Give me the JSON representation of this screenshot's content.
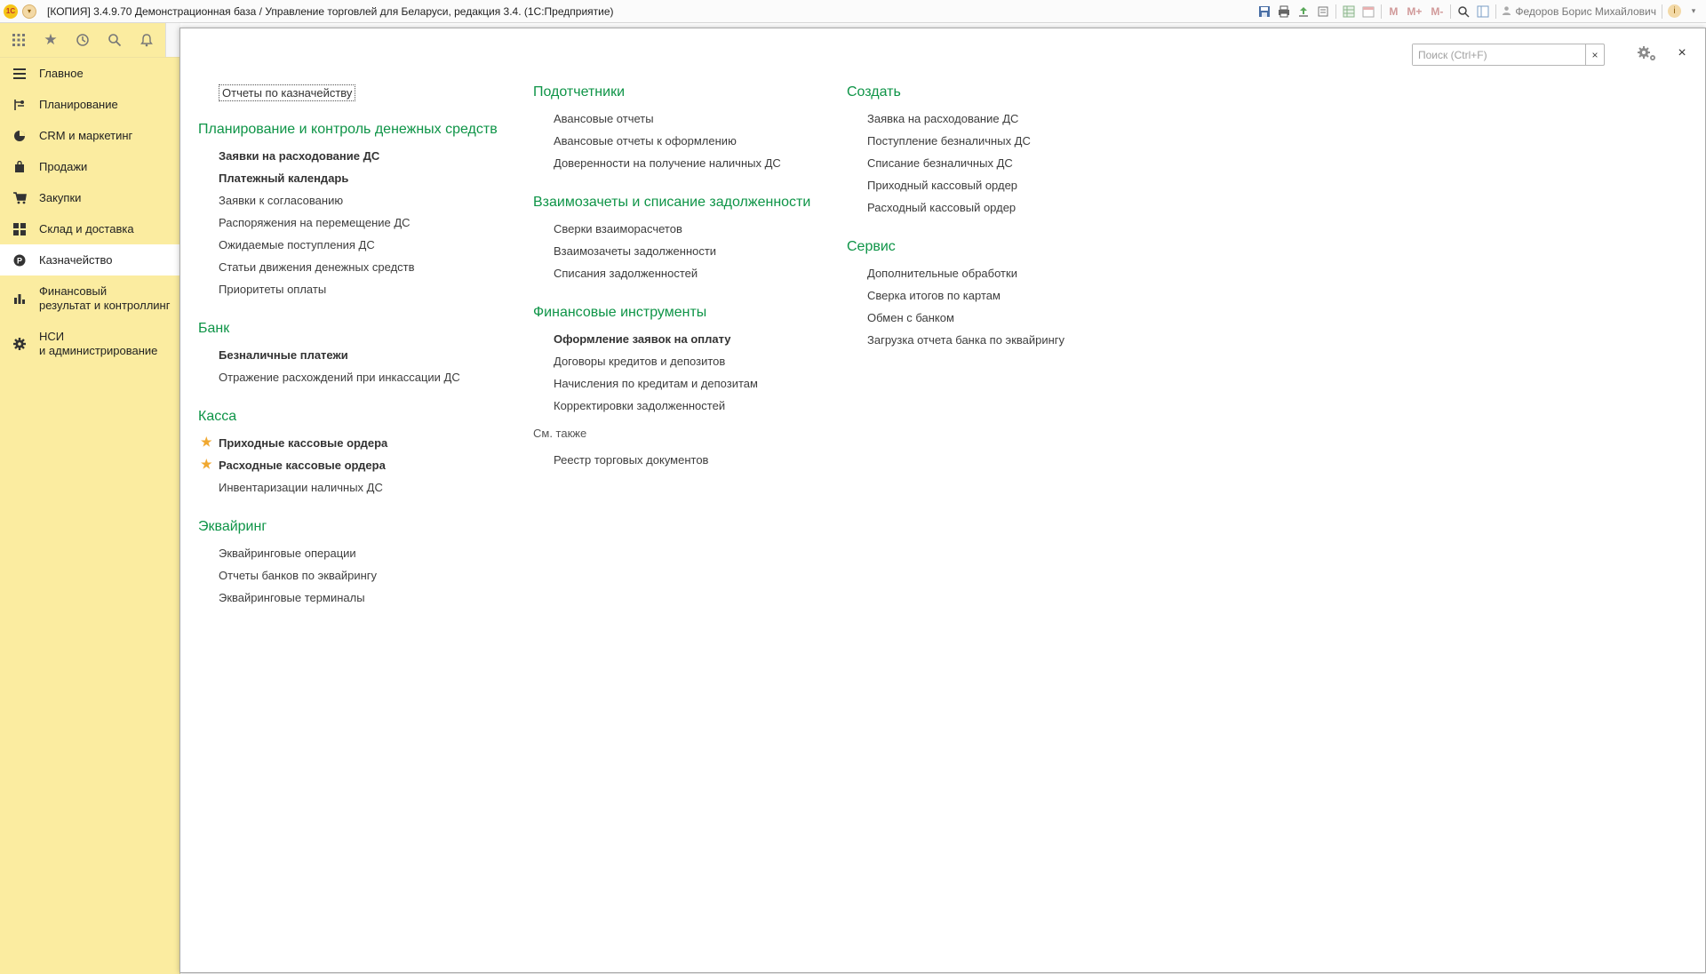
{
  "titlebar": {
    "logo": "1С",
    "title": "[КОПИЯ] 3.4.9.70 Демонстрационная база / Управление торговлей для Беларуси, редакция 3.4.   (1С:Предприятие)",
    "m": "M",
    "m_plus": "M+",
    "m_minus": "M-",
    "user": "Федоров Борис Михайлович"
  },
  "sidebar": {
    "items": [
      {
        "label": "Главное",
        "icon": "menu-icon"
      },
      {
        "label": "Планирование",
        "icon": "planning-icon"
      },
      {
        "label": "CRM и маркетинг",
        "icon": "crm-icon"
      },
      {
        "label": "Продажи",
        "icon": "bag-icon"
      },
      {
        "label": "Закупки",
        "icon": "cart-icon"
      },
      {
        "label": "Склад и доставка",
        "icon": "warehouse-icon"
      },
      {
        "label": "Казначейство",
        "icon": "treasury-icon"
      },
      {
        "label": "Финансовый\nрезультат и контроллинг",
        "icon": "chart-icon"
      },
      {
        "label": "НСИ\nи администрирование",
        "icon": "gear-icon"
      }
    ]
  },
  "search": {
    "placeholder": "Поиск (Ctrl+F)",
    "clear": "×"
  },
  "close": "×",
  "col1": {
    "reports_button": "Отчеты по казначейству",
    "sections": [
      {
        "title": "Планирование и контроль денежных средств",
        "items": [
          {
            "label": "Заявки на расходование ДС",
            "bold": true
          },
          {
            "label": "Платежный календарь",
            "bold": true
          },
          {
            "label": "Заявки к согласованию"
          },
          {
            "label": "Распоряжения на перемещение ДС"
          },
          {
            "label": "Ожидаемые поступления ДС"
          },
          {
            "label": "Статьи движения денежных средств"
          },
          {
            "label": "Приоритеты оплаты"
          }
        ]
      },
      {
        "title": "Банк",
        "items": [
          {
            "label": "Безналичные платежи",
            "bold": true
          },
          {
            "label": "Отражение расхождений при инкассации ДС"
          }
        ]
      },
      {
        "title": "Касса",
        "items": [
          {
            "label": "Приходные кассовые ордера",
            "bold": true,
            "star": "★"
          },
          {
            "label": "Расходные кассовые ордера",
            "bold": true,
            "star": "★"
          },
          {
            "label": "Инвентаризации наличных ДС"
          }
        ]
      },
      {
        "title": "Эквайринг",
        "items": [
          {
            "label": "Эквайринговые операции"
          },
          {
            "label": "Отчеты банков по эквайрингу"
          },
          {
            "label": "Эквайринговые терминалы"
          }
        ]
      }
    ]
  },
  "col2": {
    "sections": [
      {
        "title": "Подотчетники",
        "items": [
          {
            "label": "Авансовые отчеты"
          },
          {
            "label": "Авансовые отчеты к оформлению"
          },
          {
            "label": "Доверенности на получение наличных ДС"
          }
        ]
      },
      {
        "title": "Взаимозачеты и списание задолженности",
        "items": [
          {
            "label": "Сверки взаиморасчетов"
          },
          {
            "label": "Взаимозачеты задолженности"
          },
          {
            "label": "Списания задолженностей"
          }
        ]
      },
      {
        "title": "Финансовые инструменты",
        "items": [
          {
            "label": "Оформление заявок на оплату",
            "bold": true
          },
          {
            "label": "Договоры кредитов и депозитов"
          },
          {
            "label": "Начисления по кредитам и депозитам"
          },
          {
            "label": "Корректировки задолженностей"
          }
        ]
      }
    ],
    "see_also": "См. также",
    "see_also_items": [
      {
        "label": "Реестр торговых документов"
      }
    ]
  },
  "col3": {
    "sections": [
      {
        "title": "Создать",
        "items": [
          {
            "label": "Заявка на расходование ДС"
          },
          {
            "label": "Поступление безналичных ДС"
          },
          {
            "label": "Списание безналичных ДС"
          },
          {
            "label": "Приходный кассовый ордер"
          },
          {
            "label": "Расходный кассовый ордер"
          }
        ]
      },
      {
        "title": "Сервис",
        "items": [
          {
            "label": "Дополнительные обработки"
          },
          {
            "label": "Сверка итогов по картам"
          },
          {
            "label": "Обмен с банком"
          },
          {
            "label": "Загрузка отчета банка по эквайрингу"
          }
        ]
      }
    ]
  },
  "colors": {
    "section": "#0e9447",
    "sidebar": "#fbeca0",
    "star": "#f0a830"
  }
}
